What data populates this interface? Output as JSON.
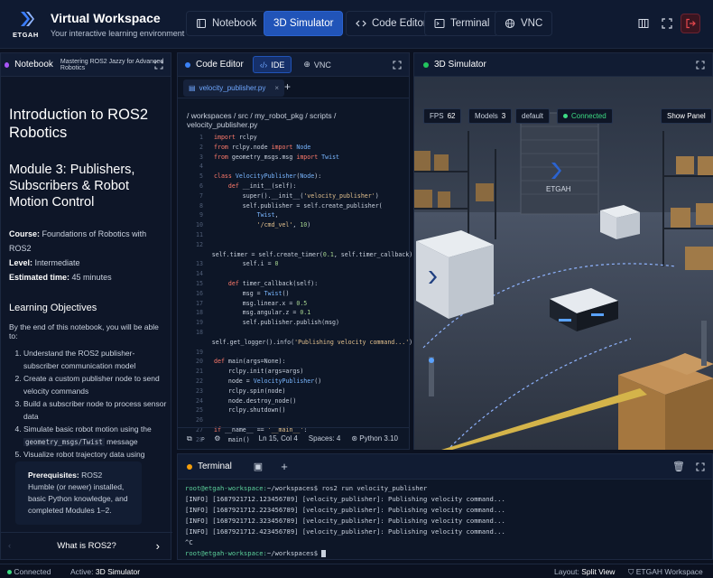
{
  "header": {
    "logo_text": "ETGAH",
    "title": "Virtual Workspace",
    "subtitle": "Your interactive learning environment",
    "tabs": [
      {
        "label": "Notebook",
        "icon": "book-icon"
      },
      {
        "label": "3D Simulator",
        "icon": "cube-icon"
      },
      {
        "label": "Code Editor",
        "icon": "code-icon"
      },
      {
        "label": "Terminal",
        "icon": "terminal-icon"
      },
      {
        "label": "VNC",
        "icon": "globe-icon"
      }
    ],
    "active_tab": "3D Simulator"
  },
  "notebook": {
    "panel_title": "Notebook",
    "panel_subtitle": "Mastering ROS2 Jazzy for Advanced Robotics",
    "h1": "Introduction to ROS2 Robotics",
    "h2": "Module 3: Publishers, Subscribers & Robot Motion Control",
    "course_label": "Course:",
    "course": "Foundations of Robotics with ROS2",
    "level_label": "Level:",
    "level": "Intermediate",
    "time_label": "Estimated time:",
    "time": "45 minutes",
    "objectives_title": "Learning Objectives",
    "objectives_intro": "By the end of this notebook, you will be able to:",
    "objectives": [
      "Understand the ROS2 publisher-subscriber communication model",
      "Create a custom publisher node to send velocity commands",
      "Build a subscriber node to process sensor data",
      "Visualize robot trajectory data using Python libraries"
    ],
    "obj4_pre": "Simulate basic robot motion using the",
    "obj4_code": "geometry_msgs/Twist",
    "obj4_post": "message",
    "prereq_label": "Prerequisites:",
    "prereq_text": "ROS2 Humble (or newer) installed, basic Python knowledge, and completed Modules 1–2.",
    "nav_next": "What is ROS2?"
  },
  "editor": {
    "title": "Code Editor",
    "mode_ide": "IDE",
    "mode_vnc": "VNC",
    "file": "velocity_publisher.py",
    "breadcrumb": "/ workspaces / src / my_robot_pkg / scripts / velocity_publisher.py",
    "code_lines": [
      {
        "n": "1",
        "t": "import rclpy"
      },
      {
        "n": "2",
        "t": "from rclpy.node import Node"
      },
      {
        "n": "3",
        "t": "from geometry_msgs.msg import Twist"
      },
      {
        "n": "4",
        "t": ""
      },
      {
        "n": "5",
        "t": "class VelocityPublisher(Node):"
      },
      {
        "n": "6",
        "t": "    def __init__(self):"
      },
      {
        "n": "7",
        "t": "        super().__init__('velocity_publisher')"
      },
      {
        "n": "8",
        "t": "        self.publisher = self.create_publisher("
      },
      {
        "n": "9",
        "t": "            Twist,"
      },
      {
        "n": "10",
        "t": "            '/cmd_vel', 10)"
      },
      {
        "n": "11",
        "t": ""
      },
      {
        "n": "12",
        "t": "        self.timer = self.create_timer(0.1, self.timer_callback)"
      },
      {
        "n": "13",
        "t": "        self.i = 0"
      },
      {
        "n": "14",
        "t": ""
      },
      {
        "n": "15",
        "t": "    def timer_callback(self):"
      },
      {
        "n": "16",
        "t": "        msg = Twist()"
      },
      {
        "n": "17",
        "t": "        msg.linear.x = 0.5"
      },
      {
        "n": "18",
        "t": "        msg.angular.z = 0.1"
      },
      {
        "n": "19",
        "t": "        self.publisher.publish(msg)"
      },
      {
        "n": "18",
        "t": "        self.get_logger().info('Publishing velocity command...')"
      },
      {
        "n": "19",
        "t": ""
      },
      {
        "n": "20",
        "t": "def main(args=None):"
      },
      {
        "n": "21",
        "t": "    rclpy.init(args=args)"
      },
      {
        "n": "22",
        "t": "    node = VelocityPublisher()"
      },
      {
        "n": "23",
        "t": "    rclpy.spin(node)"
      },
      {
        "n": "24",
        "t": "    node.destroy_node()"
      },
      {
        "n": "25",
        "t": "    rclpy.shutdown()"
      },
      {
        "n": "26",
        "t": ""
      },
      {
        "n": "27",
        "t": "if __name__ == '__main__':"
      },
      {
        "n": "28",
        "t": "    main()"
      }
    ],
    "status_pos": "Ln 15, Col 4",
    "status_spaces": "Spaces: 4",
    "status_lang": "Python 3.10"
  },
  "simulator": {
    "title": "3D Simulator",
    "fps_label": "FPS",
    "fps": "62",
    "models_label": "Models",
    "models": "3",
    "scene": "default",
    "connection": "Connected",
    "show_panel": "Show Panel",
    "logo_text": "ETGAH"
  },
  "terminal": {
    "title": "Terminal",
    "lines": [
      {
        "prompt": "root@etgah-workspace:",
        "rest": "~/workspaces$ ros2 run velocity_publisher"
      },
      {
        "prompt": "",
        "rest": "[INFO] [1687921712.123456789] [velocity_publisher]: Publishing velocity command..."
      },
      {
        "prompt": "",
        "rest": "[INFO] [1687921712.223456789] [velocity_publisher]: Publishing velocity command..."
      },
      {
        "prompt": "",
        "rest": "[INFO] [1687921712.323456789] [velocity_publisher]: Publishing velocity command..."
      },
      {
        "prompt": "",
        "rest": "[INFO] [1687921712.423456789] [velocity_publisher]: Publishing velocity command..."
      },
      {
        "prompt": "",
        "rest": "^C"
      },
      {
        "prompt": "root@etgah-workspace:",
        "rest": "~/workspaces$ "
      }
    ]
  },
  "statusbar": {
    "connection": "Connected",
    "active_label": "Active:",
    "active": "3D Simulator",
    "layout_label": "Layout:",
    "layout": "Split View",
    "brand": "ETGAH Workspace"
  },
  "colors": {
    "accent": "#2154b8",
    "success": "#3ddc84",
    "danger": "#e5484d",
    "notebook_dot": "#a855f7",
    "editor_dot": "#3b82f6",
    "sim_dot": "#22c55e",
    "terminal_dot": "#f59e0b"
  }
}
